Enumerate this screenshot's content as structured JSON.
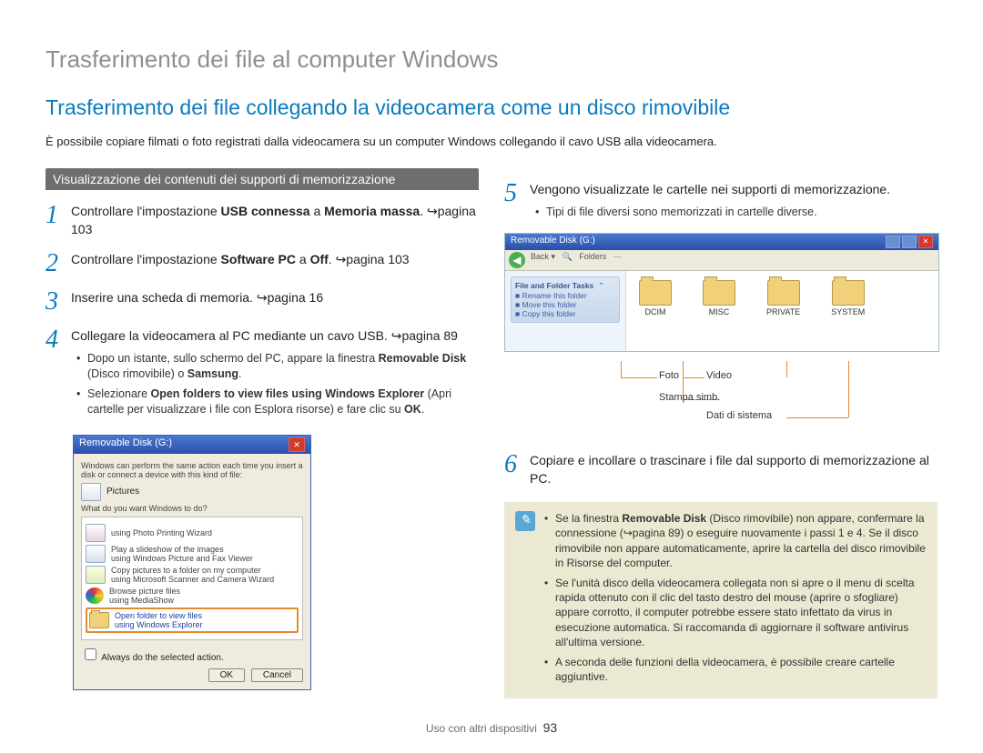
{
  "title": "Trasferimento dei file al computer Windows",
  "subtitle": "Trasferimento dei file collegando la videocamera come un disco rimovibile",
  "intro": "È possibile copiare filmati o foto registrati dalla videocamera su un computer Windows collegando il cavo USB alla videocamera.",
  "section_header": "Visualizzazione dei contenuti dei supporti di memorizzazione",
  "steps": {
    "s1_pre": "Controllare l'impostazione ",
    "s1_b1": "USB connessa",
    "s1_mid": " a ",
    "s1_b2": "Memoria massa",
    "s1_post": ". ↪pagina 103",
    "s2_pre": "Controllare l'impostazione ",
    "s2_b1": "Software PC",
    "s2_mid": " a ",
    "s2_b2": "Off",
    "s2_post": ". ↪pagina 103",
    "s3": "Inserire una scheda di memoria. ↪pagina 16",
    "s4": "Collegare la videocamera al PC mediante un cavo USB. ↪pagina 89",
    "s4_b1_pre": "Dopo un istante, sullo schermo del PC, appare la finestra ",
    "s4_b1_b": "Removable Disk",
    "s4_b1_post": " (Disco rimovibile) o ",
    "s4_b1_b2": "Samsung",
    "s4_b1_end": ".",
    "s4_b2_pre": "Selezionare ",
    "s4_b2_b": "Open folders to view files using Windows Explorer",
    "s4_b2_mid": " (Apri cartelle per visualizzare i file con Esplora risorse) e fare clic su ",
    "s4_b2_b2": "OK",
    "s4_b2_end": ".",
    "s5": "Vengono visualizzate le cartelle nei supporti di memorizzazione.",
    "s5_b1": "Tipi di file diversi sono memorizzati in cartelle diverse.",
    "s6": "Copiare e incollare o trascinare i file dal supporto di memorizzazione al PC."
  },
  "dialog": {
    "title": "Removable Disk (G:)",
    "line1": "Windows can perform the same action each time you insert a disk or connect a device with this kind of file:",
    "pictures": "Pictures",
    "question": "What do you want Windows to do?",
    "opt1": "using Photo Printing Wizard",
    "opt2a": "Play a slideshow of the images",
    "opt2b": "using Windows Picture and Fax Viewer",
    "opt3a": "Copy pictures to a folder on my computer",
    "opt3b": "using Microsoft Scanner and Camera Wizard",
    "opt4a": "Browse picture files",
    "opt4b": "using MediaShow",
    "opt5a": "Open folder to view files",
    "opt5b": "using Windows Explorer",
    "always": "Always do the selected action.",
    "ok": "OK",
    "cancel": "Cancel"
  },
  "explorer": {
    "title": "Removable Disk (G:)",
    "sidebar_title": "File and Folder Tasks",
    "sidebar_l1": "Rename this folder",
    "sidebar_l2": "Move this folder",
    "sidebar_l3": "Copy this folder",
    "folders": [
      "DCIM",
      "MISC",
      "PRIVATE",
      "SYSTEM"
    ]
  },
  "labels": {
    "foto": "Foto",
    "video": "Video",
    "stampa": "Stampa simb.",
    "dati": "Dati di sistema"
  },
  "note": {
    "n1_pre": "Se la finestra ",
    "n1_b": "Removable Disk",
    "n1_post": " (Disco rimovibile) non appare, confermare la connessione (↪pagina 89) o eseguire nuovamente i passi 1 e 4. Se il disco rimovibile non appare automaticamente, aprire la cartella del disco rimovibile in Risorse del computer.",
    "n2": "Se l'unità disco della videocamera collegata non si apre o il menu di scelta rapida ottenuto con il clic del tasto destro del mouse (aprire o sfogliare) appare corrotto, il computer potrebbe essere stato infettato da virus in esecuzione automatica. Si raccomanda di aggiornare il software antivirus all'ultima versione.",
    "n3": "A seconda delle funzioni della videocamera, è possibile creare cartelle aggiuntive."
  },
  "footer": {
    "text": "Uso con altri dispositivi",
    "page": "93"
  }
}
